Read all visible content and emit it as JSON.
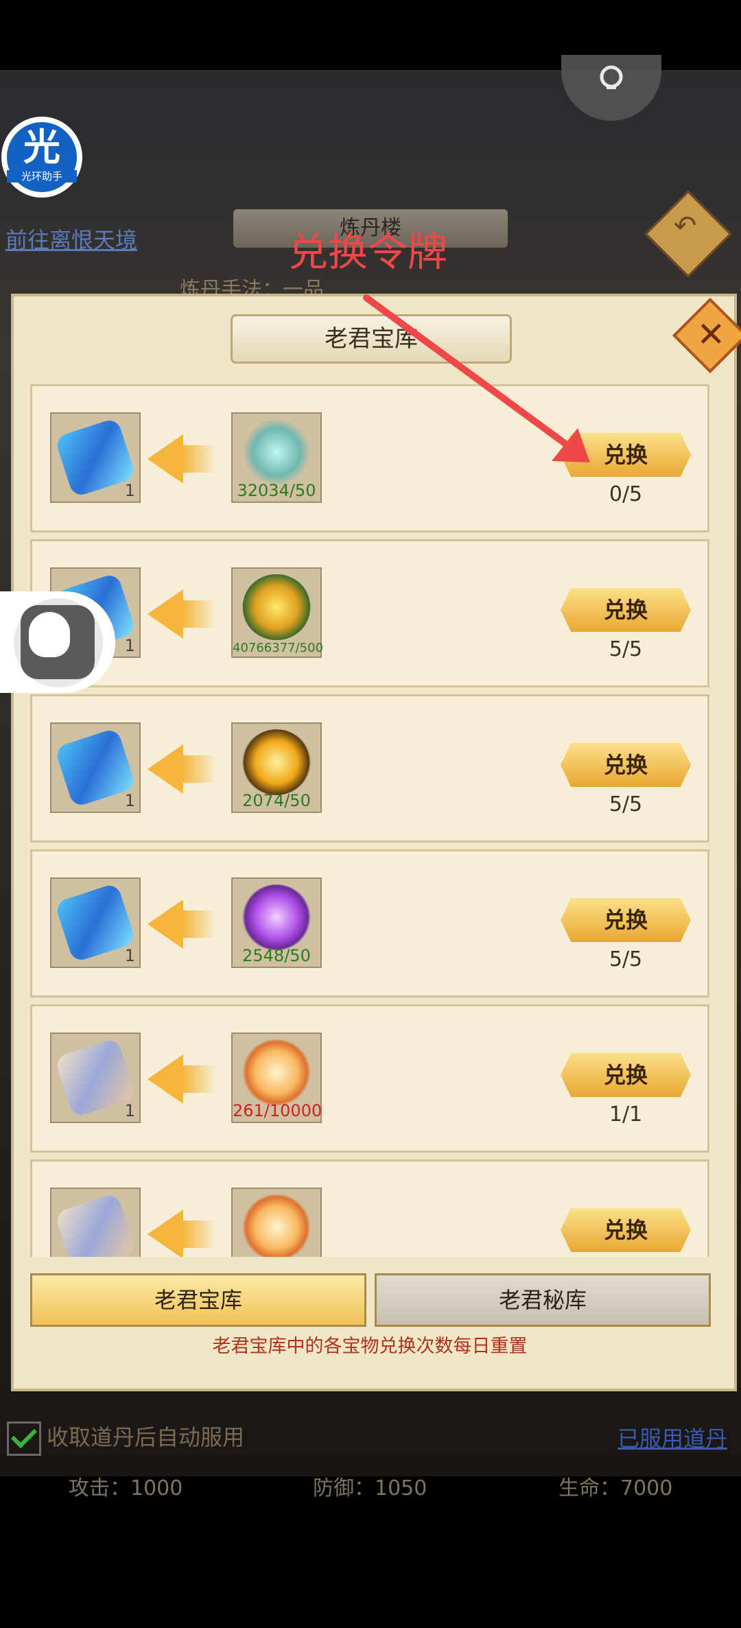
{
  "background": {
    "link_go": "前往离恨天境",
    "furnace_title": "炼丹楼",
    "hint": "炼丹手法：一品",
    "auto_use": "收取道丹后自动服用",
    "used_pills": "已服用道丹",
    "stats": {
      "attack": "攻击：1000",
      "defense": "防御：1050",
      "life": "生命：7000"
    }
  },
  "helper": {
    "big": "光",
    "small": "光环助手"
  },
  "annotation": "兑换令牌",
  "panel": {
    "title": "老君宝库",
    "close_icon": "close-icon"
  },
  "rows": [
    {
      "token_qty": "1",
      "token_icon": "blue-token-icon",
      "item_icon": "sword-icon",
      "item_progress": "32034/50",
      "button": "兑换",
      "count": "0/5"
    },
    {
      "token_qty": "1",
      "token_icon": "blue-token-icon",
      "item_icon": "flame-altar-icon",
      "item_progress": "40766377/500",
      "button": "兑换",
      "count": "5/5"
    },
    {
      "token_qty": "1",
      "token_icon": "blue-token-icon",
      "item_icon": "golden-fire-icon",
      "item_progress": "2074/50",
      "button": "兑换",
      "count": "5/5"
    },
    {
      "token_qty": "1",
      "token_icon": "blue-token-icon",
      "item_icon": "purple-fire-icon",
      "item_progress": "2548/50",
      "button": "兑换",
      "count": "5/5"
    },
    {
      "token_qty": "1",
      "token_icon": "scroll-token-icon",
      "item_icon": "crystal-icon",
      "item_progress": "261/10000",
      "button": "兑换",
      "count": "1/1"
    },
    {
      "token_qty": "",
      "token_icon": "scroll-token-icon",
      "item_icon": "crystal-icon",
      "item_progress": "",
      "button": "兑换",
      "count": ""
    }
  ],
  "tabs": {
    "active": "老君宝库",
    "inactive": "老君秘库"
  },
  "note": "老君宝库中的各宝物兑换次数每日重置"
}
